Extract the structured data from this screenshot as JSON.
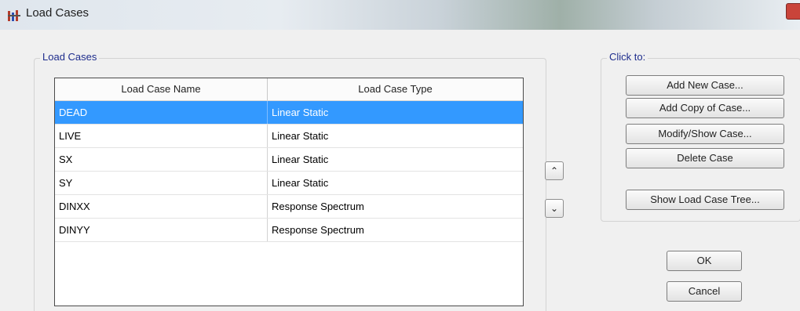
{
  "window": {
    "title": "Load Cases",
    "app_icon": "etabs-app-icon",
    "close_icon": "close-icon"
  },
  "load_cases_group": {
    "label": "Load Cases",
    "columns": [
      "Load Case Name",
      "Load Case Type"
    ],
    "rows": [
      {
        "name": "DEAD",
        "type": "Linear Static",
        "selected": true
      },
      {
        "name": "LIVE",
        "type": "Linear Static",
        "selected": false
      },
      {
        "name": "SX",
        "type": "Linear Static",
        "selected": false
      },
      {
        "name": "SY",
        "type": "Linear Static",
        "selected": false
      },
      {
        "name": "DINXX",
        "type": "Response Spectrum",
        "selected": false
      },
      {
        "name": "DINYY",
        "type": "Response Spectrum",
        "selected": false
      }
    ],
    "move_up_icon": "double-chevron-up-icon",
    "move_down_icon": "double-chevron-down-icon"
  },
  "click_to_group": {
    "label": "Click to:",
    "buttons": {
      "add_new": "Add New Case...",
      "add_copy": "Add Copy of Case...",
      "modify_show": "Modify/Show Case...",
      "delete": "Delete Case",
      "show_tree": "Show Load Case Tree..."
    }
  },
  "dialog_buttons": {
    "ok": "OK",
    "cancel": "Cancel"
  },
  "colors": {
    "selection": "#3399ff",
    "group_label": "#1d2c8c"
  }
}
